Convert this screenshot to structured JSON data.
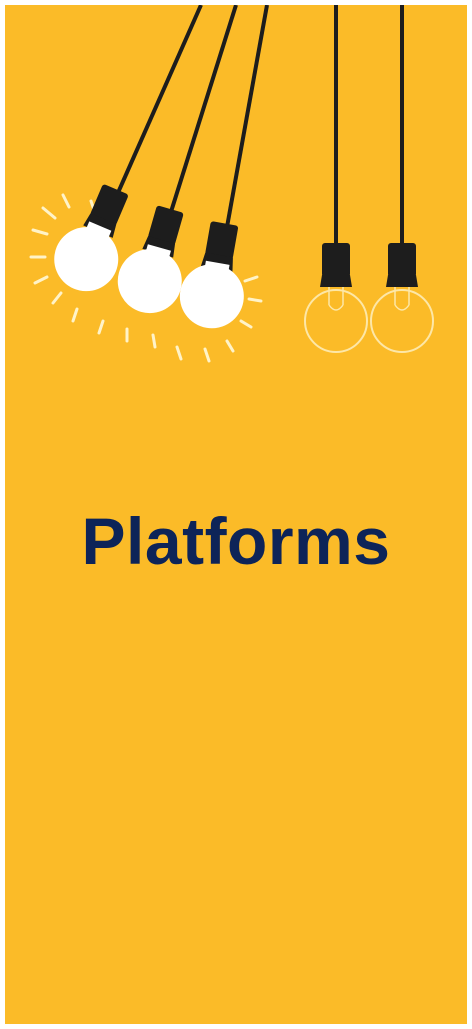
{
  "banner": {
    "title": "Platforms",
    "background_color": "#fbbb28",
    "title_color": "#0d2458"
  },
  "illustration": {
    "lit_bulbs": 3,
    "unlit_bulbs": 2,
    "icons": [
      "lit-bulb-icon",
      "lit-bulb-icon",
      "lit-bulb-icon",
      "unlit-bulb-icon",
      "unlit-bulb-icon"
    ]
  }
}
